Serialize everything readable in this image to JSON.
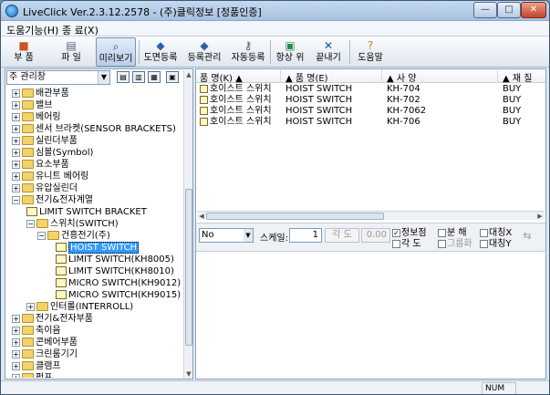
{
  "window": {
    "title": "LiveClick Ver.2.3.12.2578 - (주)클릭정보 [정품인증]",
    "min_glyph": "—",
    "max_glyph": "□",
    "close_glyph": "✕"
  },
  "menubar": {
    "items": [
      "도움기능(H)",
      "종 료(X)"
    ]
  },
  "toolbar": {
    "buttons": [
      {
        "label": "부 품",
        "icon": "cube-icon"
      },
      {
        "label": "파 일",
        "icon": "printer-icon"
      },
      {
        "label": "미리보기",
        "icon": "magnifier-icon"
      },
      {
        "label": "도면등록",
        "icon": "drawing-register-icon"
      },
      {
        "label": "등록관리",
        "icon": "register-manage-icon"
      },
      {
        "label": "자동등록",
        "icon": "key-icon"
      },
      {
        "label": "항상 위",
        "icon": "pin-icon"
      },
      {
        "label": "끝내기",
        "icon": "exit-icon"
      },
      {
        "label": "도움말",
        "icon": "help-icon"
      }
    ]
  },
  "category": {
    "selected": "주 관리창"
  },
  "tree": [
    {
      "label": "배관부품",
      "type": "folder",
      "expander": "+"
    },
    {
      "label": "밸브",
      "type": "folder",
      "expander": "+"
    },
    {
      "label": "베어링",
      "type": "folder",
      "expander": "+"
    },
    {
      "label": "센서 브라켓(SENSOR BRACKETS)",
      "type": "folder",
      "expander": "+"
    },
    {
      "label": "실린더부품",
      "type": "folder",
      "expander": "+"
    },
    {
      "label": "심볼(Symbol)",
      "type": "folder",
      "expander": "+"
    },
    {
      "label": "요소부품",
      "type": "folder",
      "expander": "+"
    },
    {
      "label": "유니트 베어링",
      "type": "folder",
      "expander": "+"
    },
    {
      "label": "유압실린더",
      "type": "folder",
      "expander": "+"
    },
    {
      "label": "전기&전자계열",
      "type": "folder",
      "expander": "−"
    },
    {
      "label": "LIMIT SWITCH BRACKET",
      "type": "part",
      "expander": ""
    },
    {
      "label": "스위치(SWITCH)",
      "type": "folder",
      "expander": "−"
    },
    {
      "label": "건흥전기(주)",
      "type": "folder",
      "expander": "−"
    },
    {
      "label": "HOIST SWITCH",
      "type": "part",
      "expander": "",
      "selected": true
    },
    {
      "label": "LIMIT SWITCH(KH8005)",
      "type": "part",
      "expander": ""
    },
    {
      "label": "LIMIT SWITCH(KH8010)",
      "type": "part",
      "expander": ""
    },
    {
      "label": "MICRO SWITCH(KH9012)",
      "type": "part",
      "expander": ""
    },
    {
      "label": "MICRO SWITCH(KH9015)",
      "type": "part",
      "expander": ""
    },
    {
      "label": "인터롤(INTERROLL)",
      "type": "folder",
      "expander": "+"
    },
    {
      "label": "전기&전자부품",
      "type": "folder",
      "expander": "+"
    },
    {
      "label": "축이음",
      "type": "folder",
      "expander": "+"
    },
    {
      "label": "콘베어부품",
      "type": "folder",
      "expander": "+"
    },
    {
      "label": "크린룸기기",
      "type": "folder",
      "expander": "+"
    },
    {
      "label": "클램프",
      "type": "folder",
      "expander": "+"
    },
    {
      "label": "펌프",
      "type": "folder",
      "expander": "+"
    }
  ],
  "grid": {
    "headers": [
      "품 명(K) ▲",
      "▲ 품 명(E)",
      "▲ 사 양",
      "▲ 재 질"
    ],
    "rows": [
      [
        "호이스트 스위치",
        "HOIST SWITCH",
        "KH-704",
        "BUY"
      ],
      [
        "호이스트 스위치",
        "HOIST SWITCH",
        "KH-702",
        "BUY"
      ],
      [
        "호이스트 스위치",
        "HOIST SWITCH",
        "KH-7062",
        "BUY"
      ],
      [
        "호이스트 스위치",
        "HOIST SWITCH",
        "KH-706",
        "BUY"
      ]
    ]
  },
  "viewbar": {
    "mode": "No preview",
    "scale_label": "스케일:",
    "scale_value": "1",
    "angle_label": "각 도",
    "angle_value": "0.00",
    "checks": [
      {
        "label": "정보점",
        "checked": true,
        "disabled": false
      },
      {
        "label": "각  도",
        "checked": false,
        "disabled": false
      },
      {
        "label": "분  해",
        "checked": false,
        "disabled": false
      },
      {
        "label": "그룹화",
        "checked": false,
        "disabled": true
      },
      {
        "label": "대칭X",
        "checked": false,
        "disabled": false
      },
      {
        "label": "대칭Y",
        "checked": false,
        "disabled": false
      }
    ]
  },
  "status": {
    "num": "NUM"
  }
}
